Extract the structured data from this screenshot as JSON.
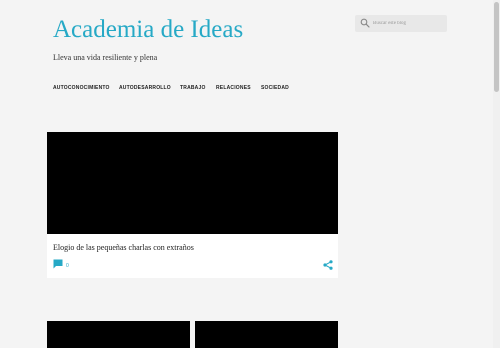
{
  "header": {
    "title": "Academia de Ideas",
    "tagline": "Lleva una vida resiliente y plena"
  },
  "search": {
    "placeholder": "Buscar este blog"
  },
  "nav": {
    "items": [
      {
        "label": "AUTOCONOCIMIENTO"
      },
      {
        "label": "AUTODESARROLLO"
      },
      {
        "label": "TRABAJO"
      },
      {
        "label": "RELACIONES"
      },
      {
        "label": "SOCIEDAD"
      }
    ]
  },
  "posts": [
    {
      "title": "Elogio de las pequeñas charlas con extraños",
      "comment_count": "0"
    }
  ],
  "colors": {
    "accent": "#26a9c6",
    "background": "#f4f4f4",
    "thumbnail": "#000000"
  },
  "icons": {
    "search": "search-icon",
    "comment": "comment-icon",
    "share": "share-icon"
  }
}
